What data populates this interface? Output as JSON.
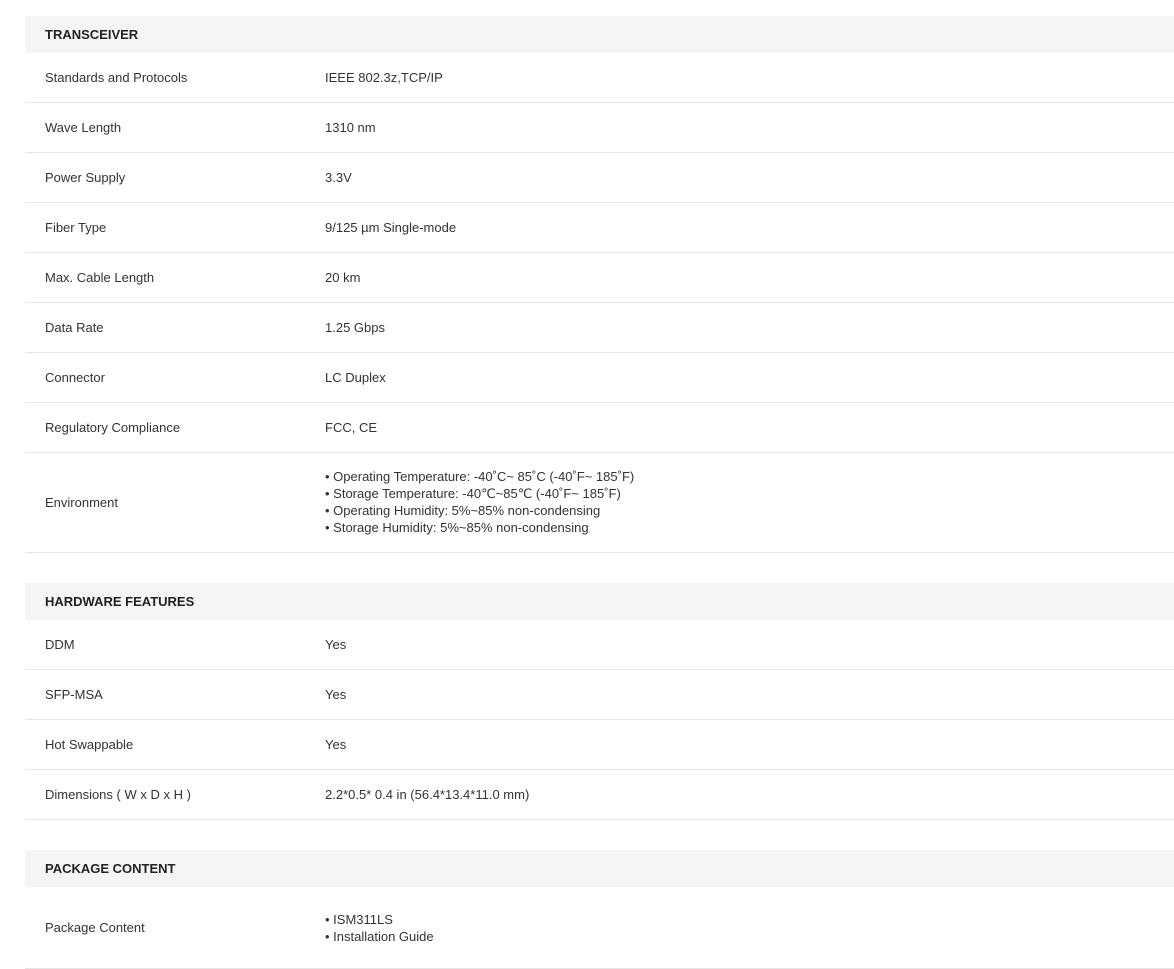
{
  "sections": [
    {
      "title": "TRANSCEIVER",
      "rows": [
        {
          "label": "Standards and Protocols",
          "value": "IEEE 802.3z,TCP/IP"
        },
        {
          "label": "Wave Length",
          "value": "1310 nm"
        },
        {
          "label": "Power Supply",
          "value": "3.3V"
        },
        {
          "label": "Fiber Type",
          "value": "9/125 µm Single-mode"
        },
        {
          "label": "Max. Cable Length",
          "value": "20 km"
        },
        {
          "label": "Data Rate",
          "value": "1.25 Gbps"
        },
        {
          "label": "Connector",
          "value": "LC Duplex"
        },
        {
          "label": "Regulatory Compliance",
          "value": "FCC, CE"
        },
        {
          "label": "Environment",
          "items": [
            "Operating Temperature: -40˚C~ 85˚C (-40˚F~ 185˚F)",
            "Storage Temperature: -40℃~85℃ (-40˚F~ 185˚F)",
            "Operating Humidity: 5%~85% non-condensing",
            "Storage Humidity: 5%~85% non-condensing"
          ]
        }
      ]
    },
    {
      "title": "HARDWARE FEATURES",
      "rows": [
        {
          "label": "DDM",
          "value": "Yes"
        },
        {
          "label": "SFP-MSA",
          "value": "Yes"
        },
        {
          "label": "Hot Swappable",
          "value": "Yes"
        },
        {
          "label": "Dimensions ( W x D x H )",
          "value": "2.2*0.5* 0.4 in (56.4*13.4*11.0 mm)"
        }
      ]
    },
    {
      "title": "PACKAGE CONTENT",
      "rows": [
        {
          "label": "Package Content",
          "items": [
            "ISM311LS",
            "Installation Guide"
          ]
        }
      ]
    }
  ]
}
